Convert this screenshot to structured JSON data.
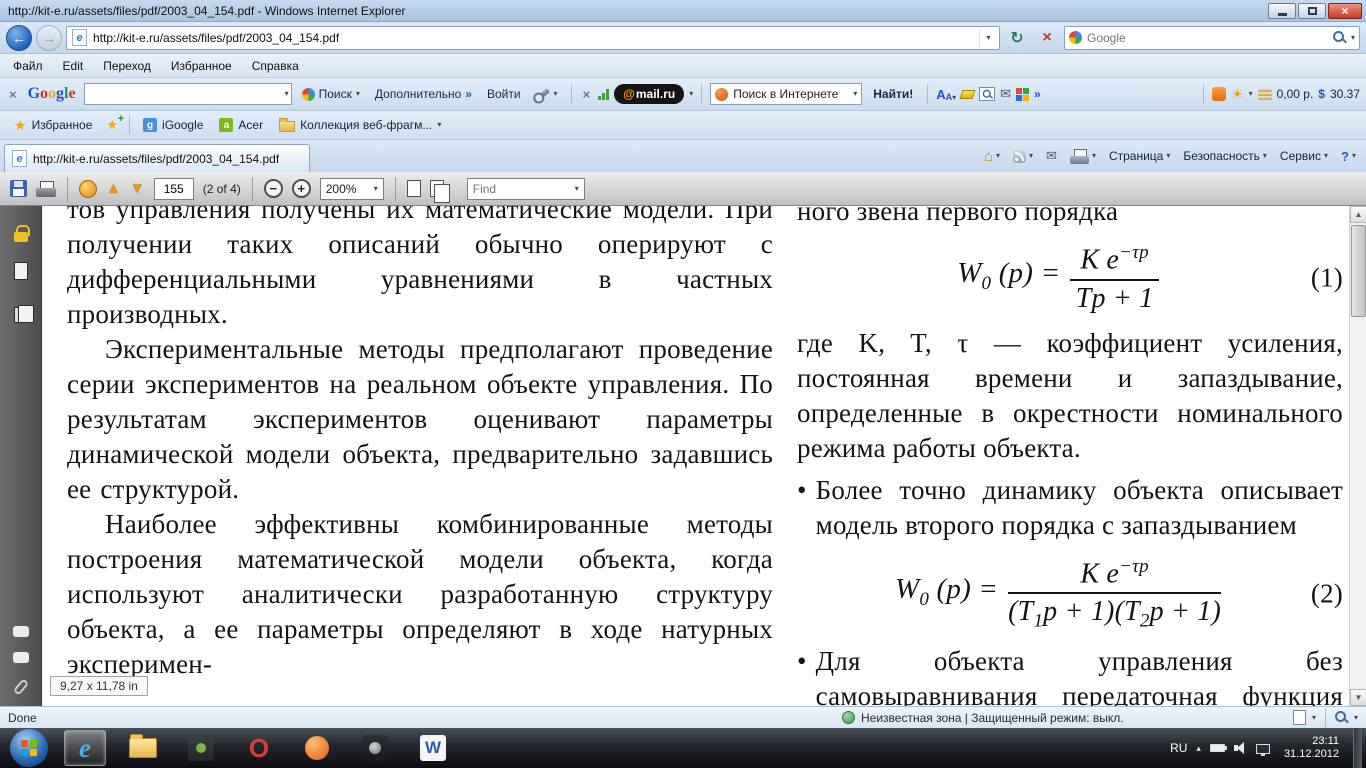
{
  "window": {
    "title": "http://kit-e.ru/assets/files/pdf/2003_04_154.pdf - Windows Internet Explorer"
  },
  "icons": {
    "chevron_down": "▾",
    "chevron_right": "»",
    "back_arrow": "←",
    "forward_arrow": "→",
    "refresh": "↻",
    "stop": "×",
    "close_x": "×",
    "star": "★",
    "envelope": "✉",
    "home": "⌂",
    "help": "?",
    "sun": "☀",
    "up_arrow": "▲",
    "down_arrow": "▼",
    "minus": "−",
    "plus": "+",
    "tray_arrow": "▴",
    "g_letter": "G",
    "ie_e": "e"
  },
  "nav": {
    "url": "http://kit-e.ru/assets/files/pdf/2003_04_154.pdf",
    "search_placeholder": "Google"
  },
  "menu": {
    "items": [
      "Файл",
      "Edit",
      "Переход",
      "Избранное",
      "Справка"
    ]
  },
  "gbar": {
    "logo_letters": [
      "G",
      "o",
      "o",
      "g",
      "l",
      "e"
    ],
    "search_value": "",
    "search_btn": "Поиск",
    "more_btn": "Дополнительно",
    "signin_btn": "Войти",
    "mail_at": "@",
    "mail_label": "mail.ru",
    "websearch": "Поиск в Интернете",
    "find_btn": "Найти!",
    "font_icon": "A",
    "balance": "0,00 р.",
    "dollar": "$",
    "rate": "30.37"
  },
  "favbar": {
    "label": "Избранное",
    "item1": "iGoogle",
    "item1_glyph": "g",
    "item2": "Acer",
    "item2_glyph": "a",
    "item3": "Коллекция веб-фрагм..."
  },
  "tabrow": {
    "tab_title": "http://kit-e.ru/assets/files/pdf/2003_04_154.pdf",
    "page_btn": "Страница",
    "safety_btn": "Безопасность",
    "tools_btn": "Сервис"
  },
  "pdfbar": {
    "page_value": "155",
    "page_count": "(2 of 4)",
    "zoom_value": "200%",
    "find_label": "Find"
  },
  "pdf": {
    "left_col": {
      "p1": "тов управления получены их математические модели. При получении таких описаний обычно оперируют с дифференциальными уравнениями в частных производных.",
      "p2": "Экспериментальные методы предполагают проведение серии экспериментов на реальном объекте управления. По результатам экспериментов оценивают параметры динамической модели объекта, предварительно задавшись ее структурой.",
      "p3": "Наиболее эффективны комбинированные методы построения математической модели объекта, когда используют аналитически разработанную структуру объекта, а ее параметры определяют в ходе натурных эксперимен-"
    },
    "right_col": {
      "top_line": "ного звена первого порядка",
      "formula1": {
        "w": "W",
        "w_sub": "0",
        "args": "(p) =",
        "num_base": "K e",
        "num_sup": "−τp",
        "den": "Tp + 1",
        "tag": "(1)"
      },
      "p1": "где K, T, τ — коэффициент усиления, постоянная времени и запаздывание, определенные в окрестности номинального режима работы объекта.",
      "bullet": "•",
      "b1": "Более точно динамику объекта описывает модель второго порядка с запаздыванием",
      "formula2": {
        "w": "W",
        "w_sub": "0",
        "args": "(p) =",
        "num_base": "K e",
        "num_sup": "−τp",
        "den_a": "(T",
        "den_a_sub": "1",
        "den_b": "p + 1)(T",
        "den_b_sub": "2",
        "den_c": "p + 1)",
        "tag": "(2)"
      },
      "b2": "Для объекта управления без самовыравнивания передаточная функция имеет вид"
    },
    "size_badge": "9,27 x 11,78 in"
  },
  "status": {
    "done": "Done",
    "zone": "Неизвестная зона | Защищенный режим: выкл."
  },
  "taskbar": {
    "lang": "RU",
    "time": "23:11",
    "date": "31.12.2012",
    "ie_glyph": "e",
    "opera_glyph": "O",
    "word_glyph": "W"
  }
}
